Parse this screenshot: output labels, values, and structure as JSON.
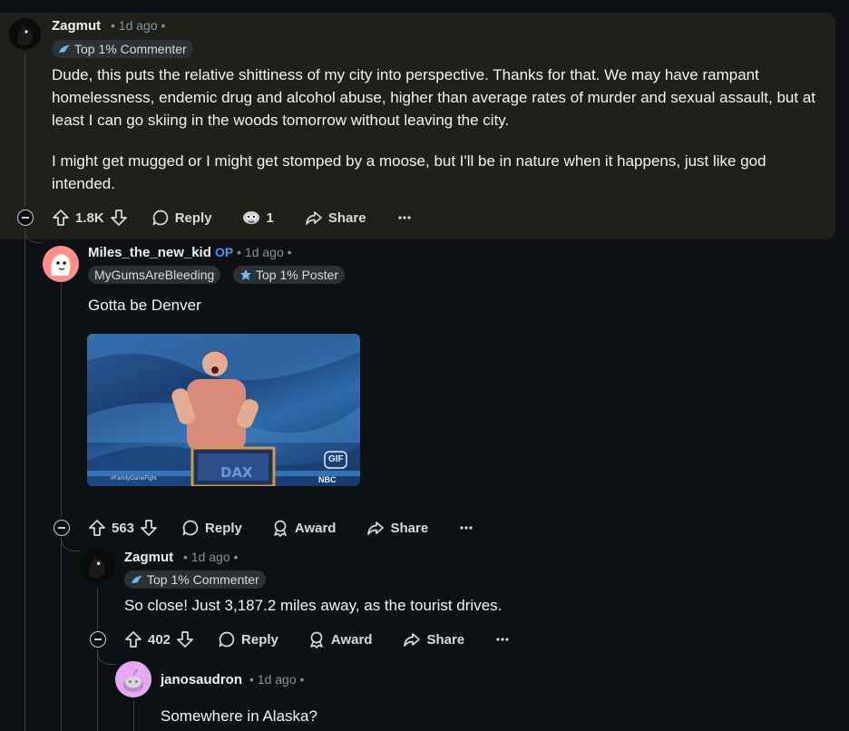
{
  "comments": [
    {
      "author": "Zagmut",
      "time": "1d ago",
      "flair": "Top 1% Commenter",
      "paragraphs": [
        "Dude, this puts the relative shittiness of my city into perspective. Thanks for that. We may have rampant homelessness, endemic drug and alcohol abuse, higher than average rates of murder and sexual assault, but at least I can go skiing in the woods tomorrow without leaving the city.",
        "I might get mugged or I might get stomped by a moose, but I'll be in nature when it happens, just like god intended."
      ],
      "votes": "1.8K",
      "award_count": "1",
      "reply_label": "Reply",
      "share_label": "Share"
    },
    {
      "author": "Miles_the_new_kid",
      "op_badge": "OP",
      "time": "1d ago",
      "user_flair": "MyGumsAreBleeding",
      "flair": "Top 1% Poster",
      "text": "Gotta be Denver",
      "gif": {
        "badge": "GIF",
        "podium_text": "DAX",
        "watermark_left": "#FamilyGameFight",
        "watermark_right": "NBC"
      },
      "votes": "563",
      "reply_label": "Reply",
      "award_label": "Award",
      "share_label": "Share"
    },
    {
      "author": "Zagmut",
      "time": "1d ago",
      "flair": "Top 1% Commenter",
      "text": "So close! Just 3,187.2 miles away, as the tourist drives.",
      "votes": "402",
      "reply_label": "Reply",
      "award_label": "Award",
      "share_label": "Share"
    },
    {
      "author": "janosaudron",
      "time": "1d ago",
      "text": "Somewhere in Alaska?"
    }
  ],
  "colors": {
    "background": "#0e1113",
    "highlight": "#1f201a",
    "op_blue": "#3d9cf5",
    "meta_gray": "#82959b"
  },
  "icons": [
    "upvote-icon",
    "downvote-icon",
    "reply-bubble-icon",
    "award-icon",
    "share-arrow-icon",
    "more-dots-icon",
    "collapse-icon"
  ]
}
